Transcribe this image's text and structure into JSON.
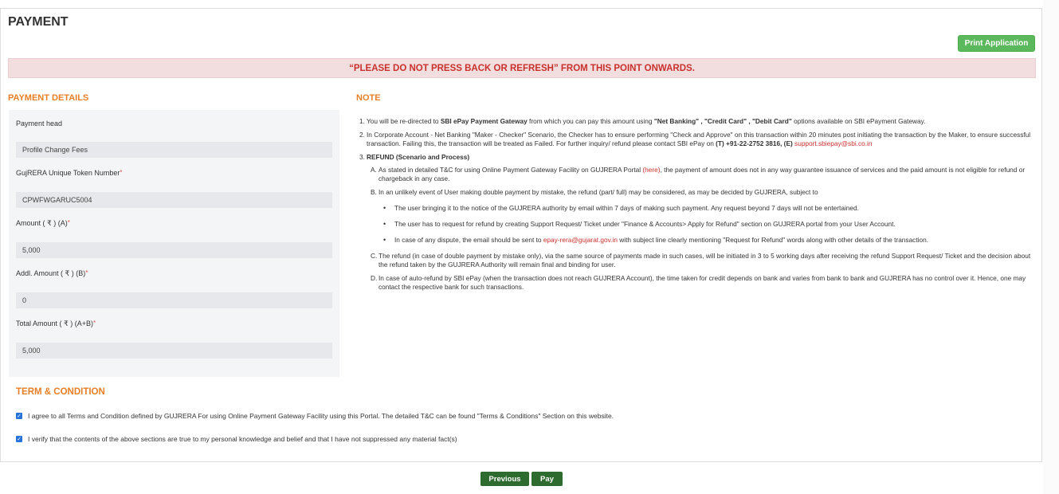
{
  "page": {
    "title": "PAYMENT",
    "print_label": "Print Application",
    "warning": "“PLEASE DO NOT PRESS BACK OR REFRESH” FROM THIS POINT ONWARDS."
  },
  "details": {
    "heading": "PAYMENT DETAILS",
    "fields": [
      {
        "label": "Payment head",
        "value": "Profile Change Fees",
        "required": ""
      },
      {
        "label": "GujRERA Unique Token Number",
        "value": "CPWFWGARUC5004",
        "required": "*"
      },
      {
        "label": "Amount ( ₹ ) (A)",
        "value": "5,000",
        "required": "*"
      },
      {
        "label": "Addl. Amount ( ₹ ) (B)",
        "value": "0",
        "required": "*"
      },
      {
        "label": "Total Amount ( ₹ ) (A+B)",
        "value": "5,000",
        "required": "*"
      }
    ]
  },
  "note": {
    "heading": "NOTE",
    "n1_num": "1.",
    "n1_a": "You will be re-directed to ",
    "n1_b": "SBI ePay Payment Gateway",
    "n1_c": " from which you can pay this amount using ",
    "n1_d": "\"Net Banking\" , \"Credit Card\" , \"Debit Card\"",
    "n1_e": " options available on SBI ePayment Gateway.",
    "n2_num": "2.",
    "n2_a": "In Corporate Account - Net Banking \"Maker - Checker\" Scenario, the Checker has to ensure performing \"Check and Approve\" on this transaction within 20 minutes post initiating the transaction by the Maker, to ensure successful transaction. Failing this, the transaction will be treated as Failed. For further inquiry/ refund please contact SBI ePay on ",
    "n2_b": "(T) +91-22-2752 3816, (E)",
    "n2_c": " support.sbiepay@sbi.co.in",
    "n3_num": "3.",
    "n3_title": "REFUND (Scenario and Process)",
    "a_letter": "A.",
    "a_1": "As stated in detailed T&C for using Online Payment Gateway Facility on GUJRERA Portal ",
    "a_link": "(here)",
    "a_2": ", the payment of amount does not in any way guarantee issuance of services and the paid amount is not eligible for refund or chargeback in any case.",
    "b_letter": "B.",
    "b_text": "In an unlikely event of User making double payment by mistake, the refund (part/ full) may be considered, as may be decided by GUJRERA, subject to",
    "bullet1": "The user bringing it to the notice of the GUJRERA authority by email within 7 days of making such payment. Any request beyond 7 days will not be entertained.",
    "bullet2": "The user has to request for refund by creating Support Request/ Ticket under \"Finance & Accounts> Apply for Refund\" section on GUJRERA portal from your User Account.",
    "bullet3_a": "In case of any dispute, the email should be sent to ",
    "bullet3_email": "epay-rera@gujarat.gov.in",
    "bullet3_b": " with subject line clearly mentioning \"Request for Refund\" words along with other details of the transaction.",
    "c_letter": "C.",
    "c_text": "The refund (in case of double payment by mistake only), via the same source of payments made in such cases, will be initiated in 3 to 5 working days after receiving the refund Support Request/ Ticket and the decision about the refund taken by the GUJRERA Authority will remain final and binding for user.",
    "d_letter": "D.",
    "d_text": "In case of auto-refund by SBI ePay (when the transaction does not reach GUJRERA Account), the time taken for credit depends on bank and varies from bank to bank and GUJRERA has no control over it. Hence, one may contact the respective bank for such transactions."
  },
  "terms": {
    "heading": "TERM & CONDITION",
    "check1": "I agree to all Terms and Condition defined by GUJRERA For using Online Payment Gateway Facility using this Portal. The detailed T&C can be found \"Terms & Conditions\" Section on this website.",
    "check2": "I verify that the contents of the above sections are true to my personal knowledge and belief and that I have not suppressed any material fact(s)"
  },
  "actions": {
    "previous": "Previous",
    "pay": "Pay"
  },
  "colors": {
    "accent": "#e87e25",
    "button_green": "#5cb85c",
    "action_green": "#2e6b2e",
    "warning_bg": "#f2dede",
    "warning_text": "#c9302c"
  }
}
